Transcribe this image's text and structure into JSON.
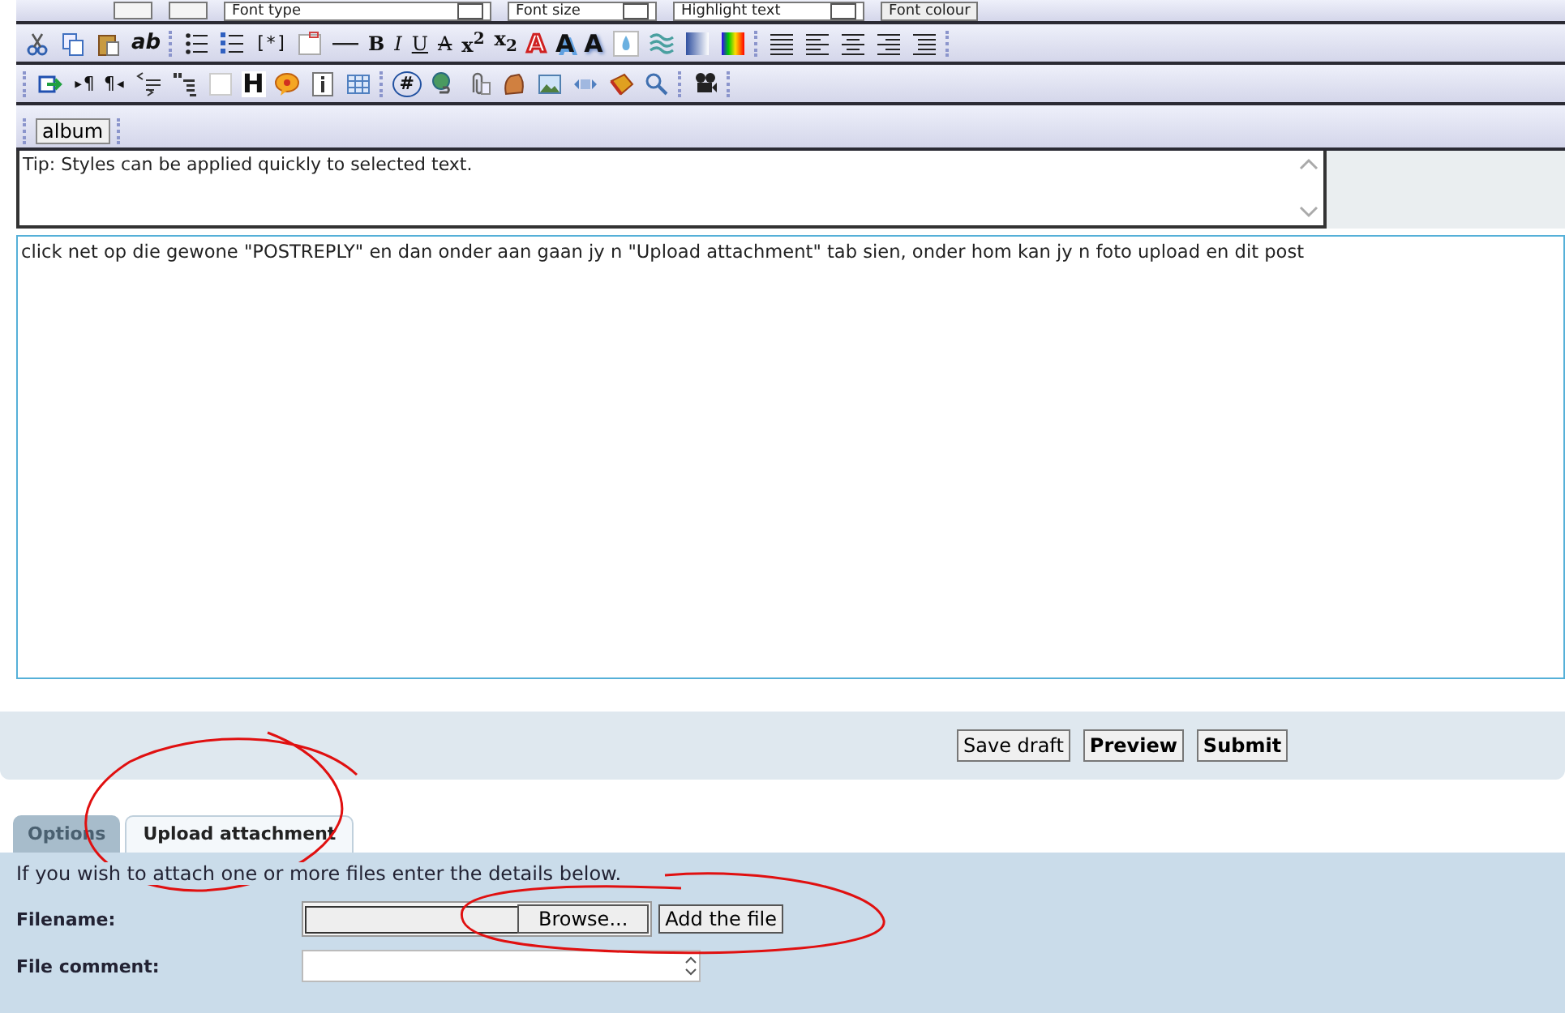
{
  "toolbar": {
    "font_menus": [
      {
        "label": "Font type"
      },
      {
        "label": "Font size"
      },
      {
        "label": "Highlight text"
      }
    ],
    "font_colour_button": "Font colour",
    "rows": [
      [
        {
          "kind": "icon"
        },
        {
          "kind": "icon"
        },
        {
          "kind": "icon"
        },
        {
          "kind": "glyph",
          "text": "ab"
        },
        {
          "kind": "separator"
        },
        {
          "kind": "icon"
        },
        {
          "kind": "icon"
        },
        {
          "kind": "glyph",
          "text": "[*]"
        },
        {
          "kind": "icon"
        },
        {
          "kind": "icon"
        },
        {
          "kind": "glyph",
          "text": "B"
        },
        {
          "kind": "glyph",
          "text": "I"
        },
        {
          "kind": "glyph",
          "text": "U"
        },
        {
          "kind": "glyph",
          "text": "A"
        },
        {
          "kind": "glyph",
          "text": "x$^{2}$"
        },
        {
          "kind": "glyph",
          "text": "x$_{2}$"
        },
        {
          "kind": "glyph",
          "text": "A"
        },
        {
          "kind": "glyph",
          "text": "A"
        },
        {
          "kind": "glyph",
          "text": "A"
        },
        {
          "kind": "icon"
        },
        {
          "kind": "icon"
        },
        {
          "kind": "icon"
        },
        {
          "kind": "icon"
        },
        {
          "kind": "separator"
        },
        {
          "kind": "icon"
        },
        {
          "kind": "icon"
        },
        {
          "kind": "icon"
        },
        {
          "kind": "icon"
        },
        {
          "kind": "icon"
        },
        {
          "kind": "separator"
        }
      ],
      [
        {
          "kind": "separator"
        },
        {
          "kind": "icon"
        },
        {
          "kind": "glyph",
          "text": "▸¶"
        },
        {
          "kind": "glyph",
          "text": "¶◂"
        },
        {
          "kind": "icon"
        },
        {
          "kind": "icon"
        },
        {
          "kind": "icon"
        },
        {
          "kind": "glyph",
          "text": "H"
        },
        {
          "kind": "icon"
        },
        {
          "kind": "icon"
        },
        {
          "kind": "icon"
        },
        {
          "kind": "separator"
        },
        {
          "kind": "glyph",
          "text": "#"
        },
        {
          "kind": "icon"
        },
        {
          "kind": "icon"
        },
        {
          "kind": "icon"
        },
        {
          "kind": "icon"
        },
        {
          "kind": "icon"
        },
        {
          "kind": "icon"
        },
        {
          "kind": "icon"
        },
        {
          "kind": "separator"
        },
        {
          "kind": "icon"
        },
        {
          "kind": "separator"
        }
      ]
    ],
    "album_button": "album"
  },
  "tip": "Tip: Styles can be applied quickly to selected text.",
  "message": "click net op die gewone \"POSTREPLY\" en dan onder aan gaan jy n \"Upload attachment\" tab sien, onder hom kan jy n foto upload en dit post",
  "actions": [
    {
      "label": "Save draft",
      "primary": false
    },
    {
      "label": "Preview",
      "primary": true
    },
    {
      "label": "Submit",
      "primary": true
    }
  ],
  "tabs": [
    {
      "label": "Options",
      "selected": false
    },
    {
      "label": "Upload attachment",
      "selected": true
    }
  ],
  "attach": {
    "intro": "If you wish to attach one or more files enter the details below.",
    "filename_label": "Filename:",
    "browse_button": "Browse...",
    "add_button": "Add the file",
    "comment_label": "File comment:"
  }
}
